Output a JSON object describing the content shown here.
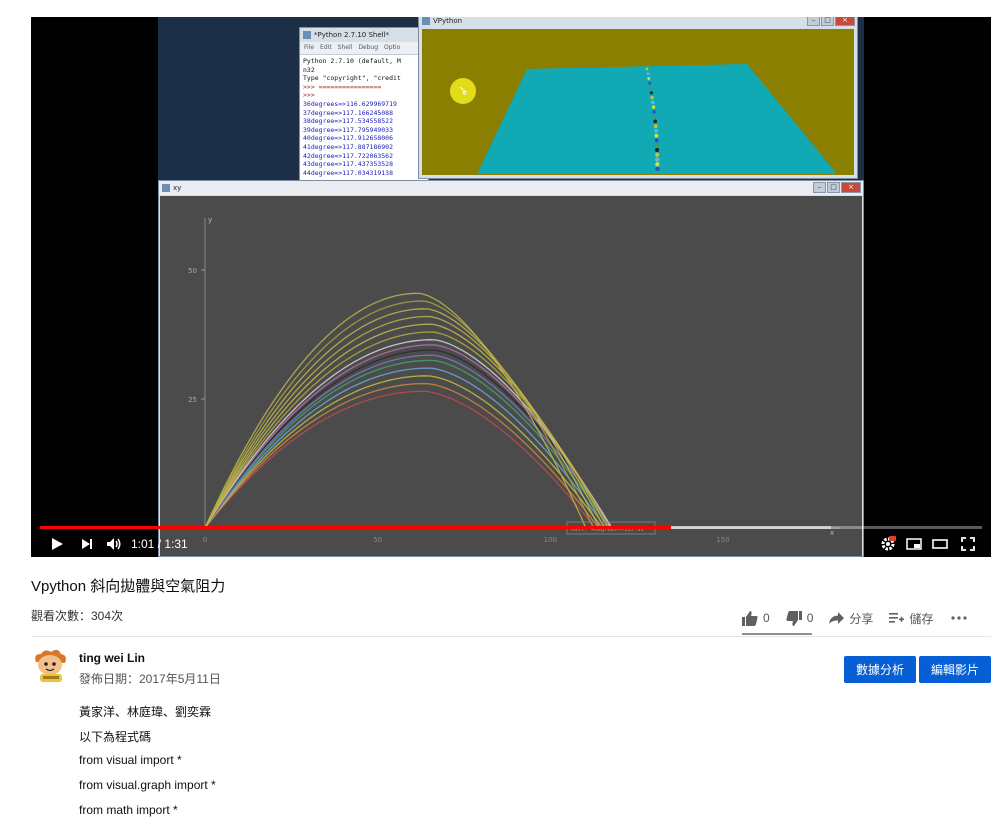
{
  "player": {
    "time_display": "1:01 / 1:31",
    "played_fraction": 0.67,
    "buffered_fraction": 0.84,
    "video_content": {
      "shell_window": {
        "title": "*Python 2.7.10 Shell*",
        "menu": [
          "File",
          "Edit",
          "Shell",
          "Debug",
          "Optio"
        ],
        "lines": [
          {
            "text": "Python 2.7.10 (default, M",
            "cls": ""
          },
          {
            "text": "n32",
            "cls": ""
          },
          {
            "text": "Type \"copyright\", \"credit",
            "cls": ""
          },
          {
            "text": ">>> ================",
            "cls": "p"
          },
          {
            "text": ">>>",
            "cls": "p"
          },
          {
            "text": "36degrees=>116.629969719",
            "cls": "b"
          },
          {
            "text": "37degree=>117.166245088",
            "cls": "b"
          },
          {
            "text": "38degree=>117.534558522",
            "cls": "b"
          },
          {
            "text": "39degree=>117.795949033",
            "cls": "b"
          },
          {
            "text": "40degree=>117.912658006",
            "cls": "b"
          },
          {
            "text": "41degree=>117.887186902",
            "cls": "b"
          },
          {
            "text": "42degree=>117.722063562",
            "cls": "b"
          },
          {
            "text": "43degree=>117.437353528",
            "cls": "b"
          },
          {
            "text": "44degree=>117.034319138",
            "cls": "b"
          }
        ]
      },
      "vpython_window": {
        "title": "VPython"
      },
      "xy_window": {
        "title": "xy"
      }
    }
  },
  "chart_data": {
    "type": "line",
    "title": "",
    "xlabel": "x",
    "ylabel": "y",
    "xlim": [
      0,
      180
    ],
    "ylim": [
      0,
      58
    ],
    "x_ticks": [
      0,
      50,
      100,
      150
    ],
    "y_ticks": [
      25,
      50
    ],
    "series_info": "trajectories for launch angles ~30-60 degrees, max height ~26 to ~46",
    "series": [
      {
        "color": "#c94848",
        "peak": 26.5,
        "range": 113
      },
      {
        "color": "#d08a3c",
        "peak": 28.0,
        "range": 114
      },
      {
        "color": "#c9c046",
        "peak": 29.5,
        "range": 115
      },
      {
        "color": "#6fa8d8",
        "peak": 31.0,
        "range": 116
      },
      {
        "color": "#3fa66a",
        "peak": 32.5,
        "range": 117
      },
      {
        "color": "#7a7ac8",
        "peak": 33.5,
        "range": 117.5
      },
      {
        "color": "#2a2a2a",
        "peak": 34.5,
        "range": 117.8
      },
      {
        "color": "#b66fb0",
        "peak": 35.5,
        "range": 117.9
      },
      {
        "color": "#d6d6d6",
        "peak": 36.5,
        "range": 117.7
      },
      {
        "color": "#b5ad3a",
        "peak": 38.0,
        "range": 117.3
      },
      {
        "color": "#c8bb54",
        "peak": 39.5,
        "range": 116.6
      },
      {
        "color": "#b9b54a",
        "peak": 41.0,
        "range": 115.6
      },
      {
        "color": "#c3b94f",
        "peak": 42.5,
        "range": 114.2
      },
      {
        "color": "#aaa244",
        "peak": 44.0,
        "range": 112.5
      },
      {
        "color": "#c2b646",
        "peak": 45.5,
        "range": 110.3
      }
    ],
    "annotation": "ball: +degrees=>117.91"
  },
  "video_title": "Vpython 斜向拋體與空氣阻力",
  "view_count": "觀看次數：304次",
  "actions": {
    "likes": "0",
    "dislikes": "0",
    "share": "分享",
    "save": "儲存"
  },
  "channel": {
    "name": "ting wei Lin",
    "publish_date": "發佈日期：2017年5月11日"
  },
  "buttons": {
    "analytics": "數據分析",
    "edit": "編輯影片"
  },
  "description": [
    "黃家洋、林庭瑋、劉奕霖",
    "以下為程式碼",
    "from visual import *",
    "from visual.graph import *",
    "from math import *"
  ],
  "icons": [
    "play-icon",
    "next-icon",
    "volume-icon",
    "settings-icon",
    "miniplayer-icon",
    "theater-icon",
    "fullscreen-icon",
    "thumb-up-icon",
    "thumb-down-icon",
    "share-icon",
    "playlist-add-icon",
    "more-icon"
  ]
}
